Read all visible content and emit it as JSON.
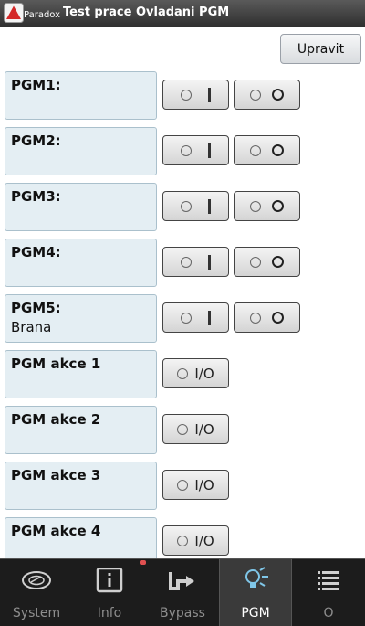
{
  "header": {
    "brand": "Paradox",
    "title": "Test prace Ovladani PGM"
  },
  "toolbar": {
    "edit_label": "Upravit"
  },
  "pgm_rows": [
    {
      "name": "PGM1:",
      "subtitle": "",
      "type": "on-off"
    },
    {
      "name": "PGM2:",
      "subtitle": "",
      "type": "on-off"
    },
    {
      "name": "PGM3:",
      "subtitle": "",
      "type": "on-off"
    },
    {
      "name": "PGM4:",
      "subtitle": "",
      "type": "on-off"
    },
    {
      "name": "PGM5:",
      "subtitle": "Brana",
      "type": "on-off"
    }
  ],
  "action_rows": [
    {
      "name": "PGM akce 1",
      "button_label": "I/O"
    },
    {
      "name": "PGM akce 2",
      "button_label": "I/O"
    },
    {
      "name": "PGM akce 3",
      "button_label": "I/O"
    },
    {
      "name": "PGM akce 4",
      "button_label": "I/O"
    }
  ],
  "tabs": [
    {
      "label": "System",
      "icon": "safe-dial-icon",
      "active": false
    },
    {
      "label": "Info",
      "icon": "info-icon",
      "active": false,
      "badge": true
    },
    {
      "label": "Bypass",
      "icon": "bypass-arrow-icon",
      "active": false
    },
    {
      "label": "PGM",
      "icon": "bulb-icon",
      "active": true
    },
    {
      "label": "O",
      "icon": "list-icon",
      "active": false
    }
  ],
  "colors": {
    "accent_red": "#d42a2a",
    "label_bg": "#e4eef3",
    "active_tab_icon": "#7fc6e8"
  }
}
